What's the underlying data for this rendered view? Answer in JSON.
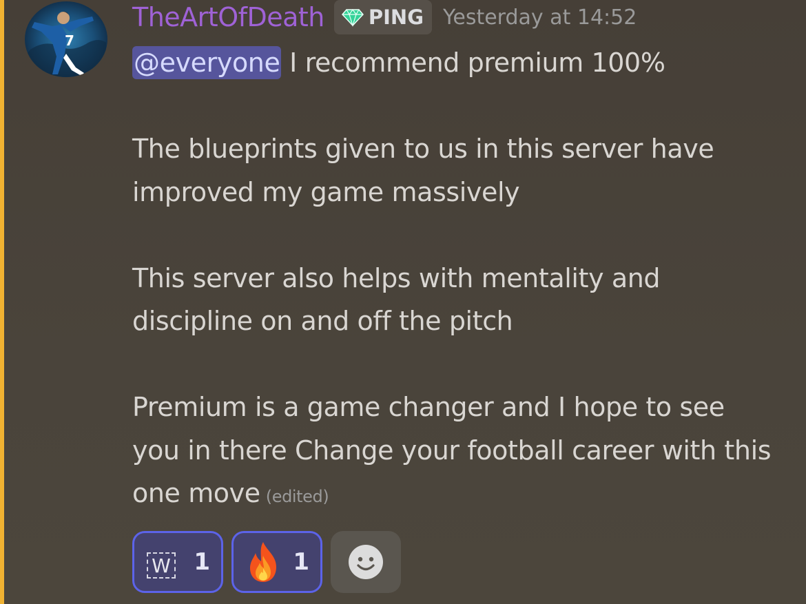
{
  "message": {
    "author": "TheArtOfDeath",
    "author_color": "#9f62d6",
    "role": {
      "label": "PING",
      "icon": "gem-icon",
      "icon_color": "#34d399"
    },
    "timestamp": "Yesterday at 14:52",
    "mention": "@everyone",
    "line1": "I recommend premium 100%",
    "paragraphs": [
      "The blueprints given to us in this server have improved my game massively",
      "This server also helps with mentality and discipline on and off the pitch",
      "Premium is a game changer and I hope to see you in there Change your football career with this one move"
    ],
    "edited_label": "(edited)",
    "mention_bar_color": "#f0b232"
  },
  "reactions": [
    {
      "emoji": "w-letter-emoji",
      "glyph": "W",
      "count": "1",
      "active": true
    },
    {
      "emoji": "fire-emoji",
      "count": "1",
      "active": true
    }
  ],
  "add_reaction_icon": "smiley-face-icon"
}
